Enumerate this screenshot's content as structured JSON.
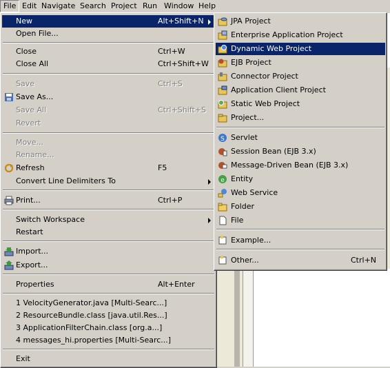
{
  "menubar": {
    "file": "File",
    "edit": "Edit",
    "navigate": "Navigate",
    "search": "Search",
    "project": "Project",
    "run": "Run",
    "window": "Window",
    "help": "Help"
  },
  "file_menu": {
    "new": {
      "label": "New",
      "shortcut": "Alt+Shift+N"
    },
    "open_file": "Open File...",
    "close": {
      "label": "Close",
      "shortcut": "Ctrl+W"
    },
    "close_all": {
      "label": "Close All",
      "shortcut": "Ctrl+Shift+W"
    },
    "save": {
      "label": "Save",
      "shortcut": "Ctrl+S"
    },
    "save_as": "Save As...",
    "save_all": {
      "label": "Save All",
      "shortcut": "Ctrl+Shift+S"
    },
    "revert": "Revert",
    "move": "Move...",
    "rename": "Rename...",
    "refresh": {
      "label": "Refresh",
      "shortcut": "F5"
    },
    "convert": "Convert Line Delimiters To",
    "print": {
      "label": "Print...",
      "shortcut": "Ctrl+P"
    },
    "switch_workspace": "Switch Workspace",
    "restart": "Restart",
    "import": "Import...",
    "export": "Export...",
    "properties": {
      "label": "Properties",
      "shortcut": "Alt+Enter"
    },
    "recent": [
      "1 VelocityGenerator.java  [Multi-Searc...]",
      "2 ResourceBundle.class  [java.util.Res...]",
      "3 ApplicationFilterChain.class  [org.a...]",
      "4 messages_hi.properties  [Multi-Searc...]"
    ],
    "exit": "Exit"
  },
  "new_menu": {
    "items": [
      {
        "label": "JPA Project",
        "icon": "jpa-project-icon"
      },
      {
        "label": "Enterprise Application Project",
        "icon": "enterprise-app-icon"
      },
      {
        "label": "Dynamic Web Project",
        "icon": "dynamic-web-icon"
      },
      {
        "label": "EJB Project",
        "icon": "ejb-project-icon"
      },
      {
        "label": "Connector Project",
        "icon": "connector-icon"
      },
      {
        "label": "Application Client Project",
        "icon": "app-client-icon"
      },
      {
        "label": "Static Web Project",
        "icon": "static-web-icon"
      },
      {
        "label": "Project...",
        "icon": "project-icon"
      }
    ],
    "items2": [
      {
        "label": "Servlet",
        "icon": "servlet-icon"
      },
      {
        "label": "Session Bean (EJB 3.x)",
        "icon": "session-bean-icon"
      },
      {
        "label": "Message-Driven Bean (EJB 3.x)",
        "icon": "mdb-icon"
      },
      {
        "label": "Entity",
        "icon": "entity-icon"
      },
      {
        "label": "Web Service",
        "icon": "web-service-icon"
      },
      {
        "label": "Folder",
        "icon": "folder-icon"
      },
      {
        "label": "File",
        "icon": "file-icon"
      }
    ],
    "example": "Example...",
    "other": {
      "label": "Other...",
      "shortcut": "Ctrl+N"
    }
  },
  "colors": {
    "menu_bg": "#d4d0c8",
    "highlight": "#0a246a",
    "disabled": "#808080"
  }
}
